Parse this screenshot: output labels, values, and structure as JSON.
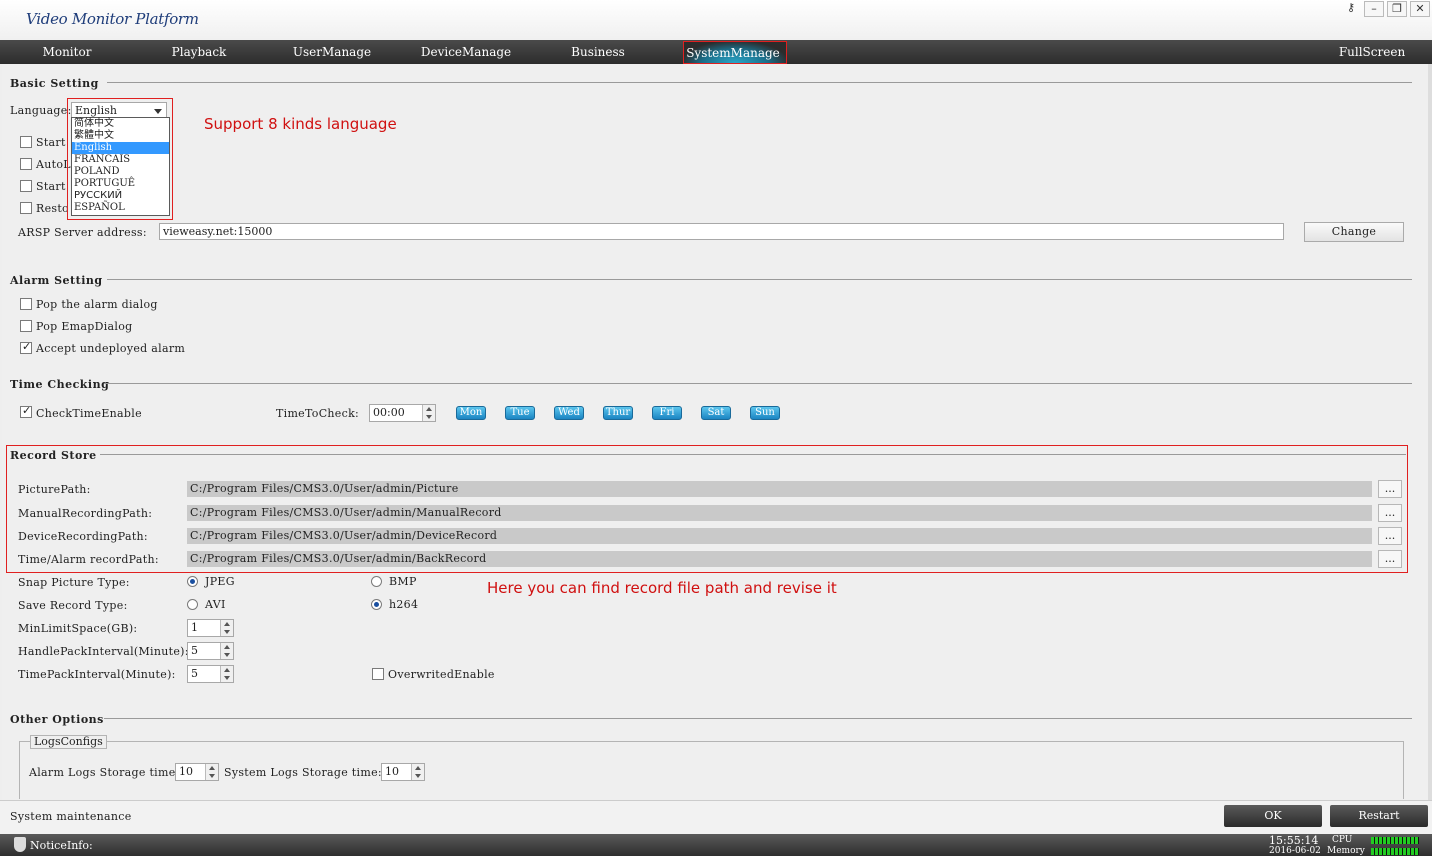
{
  "window": {
    "title": "Video Monitor Platform",
    "controls": {
      "key": "⚷",
      "minimize": "–",
      "restore": "❐",
      "close": "✕"
    }
  },
  "menu": {
    "items": [
      "Monitor",
      "Playback",
      "UserManage",
      "DeviceManage",
      "Business",
      "SystemManage"
    ],
    "active": "SystemManage",
    "fullscreen": "FullScreen"
  },
  "basic_setting": {
    "title": "Basic Setting",
    "language_label": "Language:",
    "language_value": "English",
    "language_options": [
      "简体中文",
      "繁體中文",
      "English",
      "FRANCAIS",
      "POLAND",
      "PORTUGUÊ",
      "РУССКИЙ",
      "ESPAÑOL"
    ],
    "checkboxes": [
      "Start",
      "AutoLo",
      "Start",
      "Resto"
    ],
    "arsp_label": "ARSP Server address:",
    "arsp_value": "vieweasy.net:15000",
    "change_button": "Change"
  },
  "alarm_setting": {
    "title": "Alarm Setting",
    "options": [
      {
        "label": "Pop the alarm dialog",
        "checked": false
      },
      {
        "label": "Pop EmapDialog",
        "checked": false
      },
      {
        "label": "Accept undeployed alarm",
        "checked": true
      }
    ]
  },
  "time_checking": {
    "title": "Time Checking",
    "enable_label": "CheckTimeEnable",
    "enable_checked": true,
    "time_label": "TimeToCheck:",
    "time_value": "00:00",
    "days": [
      "Mon",
      "Tue",
      "Wed",
      "Thur",
      "Fri",
      "Sat",
      "Sun"
    ]
  },
  "record_store": {
    "title": "Record Store",
    "paths": [
      {
        "label": "PicturePath:",
        "value": "C:/Program Files/CMS3.0/User/admin/Picture"
      },
      {
        "label": "ManualRecordingPath:",
        "value": "C:/Program Files/CMS3.0/User/admin/ManualRecord"
      },
      {
        "label": "DeviceRecordingPath:",
        "value": "C:/Program Files/CMS3.0/User/admin/DeviceRecord"
      },
      {
        "label": "Time/Alarm recordPath:",
        "value": "C:/Program Files/CMS3.0/User/admin/BackRecord"
      }
    ],
    "browse_label": "...",
    "snap_label": "Snap Picture Type:",
    "snap_options": [
      "JPEG",
      "BMP"
    ],
    "snap_selected": "JPEG",
    "save_label": "Save Record Type:",
    "save_options": [
      "AVI",
      "h264"
    ],
    "save_selected": "h264",
    "min_space_label": "MinLimitSpace(GB):",
    "min_space_value": "1",
    "handle_pack_label": "HandlePackInterval(Minute):",
    "handle_pack_value": "5",
    "time_pack_label": "TimePackInterval(Minute):",
    "time_pack_value": "5",
    "overwrite_label": "OverwritedEnable",
    "overwrite_checked": false
  },
  "other_options": {
    "title": "Other Options",
    "group_title": "LogsConfigs",
    "alarm_logs_label": "Alarm Logs Storage time",
    "alarm_logs_value": "10",
    "system_logs_label": "System Logs Storage time:",
    "system_logs_value": "10"
  },
  "annotations": {
    "language_note": "Support 8 kinds language",
    "record_note": "Here you can find record file path and revise it"
  },
  "footer": {
    "maintenance": "System maintenance",
    "ok_button": "OK",
    "restart_button": "Restart"
  },
  "status": {
    "notice_label": "NoticeInfo:",
    "time": "15:55:14",
    "date": "2016-06-02",
    "cpu_label": "CPU",
    "memory_label": "Memory"
  },
  "colors": {
    "accent": "#2aa7c9",
    "highlight_border": "#e02020",
    "annotation_text": "#d01010"
  }
}
